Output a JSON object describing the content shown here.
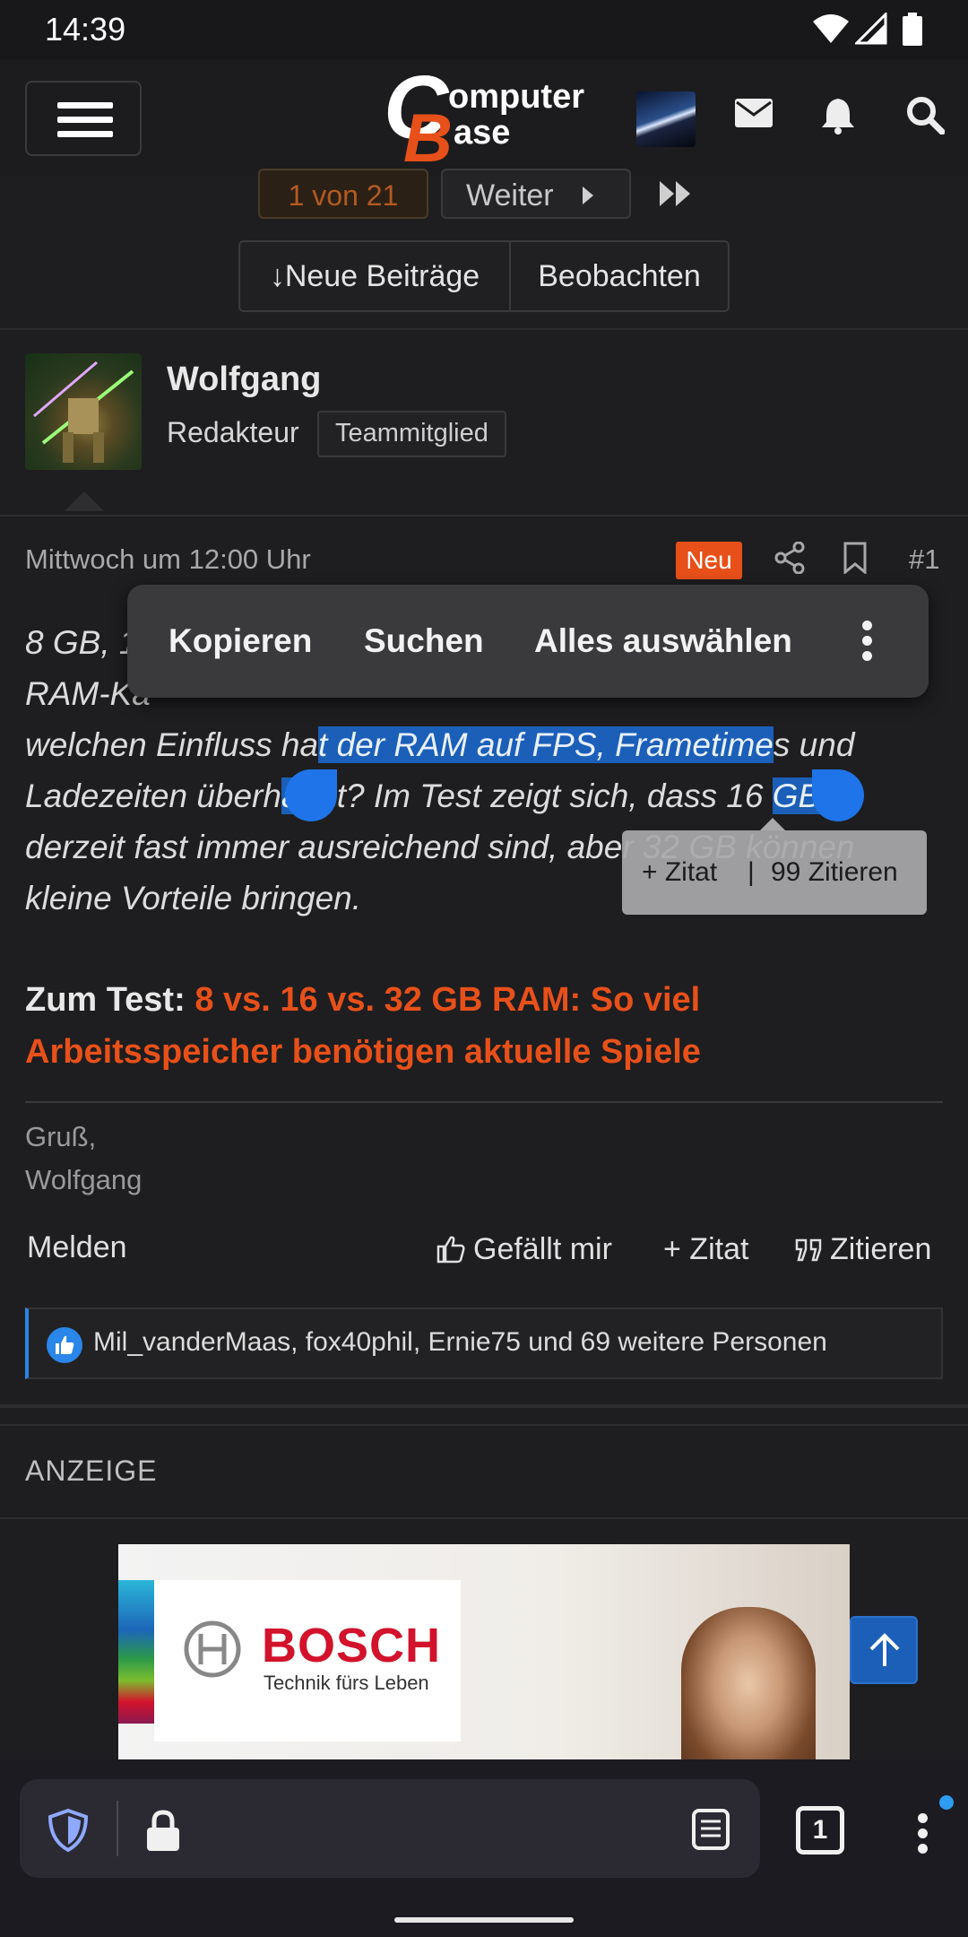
{
  "status_bar": {
    "time": "14:39"
  },
  "pagination": {
    "current": "1 von 21",
    "next": "Weiter"
  },
  "thread_buttons": {
    "new_posts": "Neue Beiträge",
    "watch": "Beobachten"
  },
  "user": {
    "name": "Wolfgang",
    "role": "Redakteur",
    "badge": "Teammitglied"
  },
  "post": {
    "date": "Mittwoch um 12:00 Uhr",
    "badge_new": "Neu",
    "number": "#1",
    "body_line1": "8 GB, 1",
    "body_line2": "RAM-Ka",
    "body_line3_pre": "welchen Einfluss ha",
    "body_line3_sel": "t der RAM auf FPS, Frametime",
    "body_line3_post": "s und",
    "body_line4_pre": "Ladezeiten überh",
    "body_line4_sel": "au",
    "body_line4_mid": "pt? Im Test zeigt sich, dass 16 ",
    "body_line4_sel2": "GB",
    "body_line5": "derzeit fast immer ausreichend sind, aber 32 GB können",
    "body_line6": "kleine Vorteile bringen.",
    "test_label": "Zum Test:",
    "test_link": "8 vs. 16 vs. 32 GB RAM: So viel Arbeitsspeicher benötigen aktuelle Spiele",
    "greeting_1": "Gruß,",
    "greeting_2": "Wolfgang"
  },
  "context_menu": {
    "copy": "Kopieren",
    "search": "Suchen",
    "select_all": "Alles auswählen"
  },
  "quote_popup": {
    "zitat": "+ Zitat",
    "separator": "|",
    "zitieren": "99 Zitieren"
  },
  "actions": {
    "report": "Melden",
    "like": "Gefällt mir",
    "quote": "+ Zitat",
    "cite": "Zitieren"
  },
  "likes": {
    "text": "Mil_vanderMaas, fox40phil, Ernie75 und 69 weitere Personen"
  },
  "ad": {
    "label": "ANZEIGE",
    "brand": "BOSCH",
    "slogan": "Technik fürs Leben"
  },
  "browser": {
    "tab_count": "1"
  },
  "colors": {
    "accent": "#e8501a",
    "selection": "#1b5fb8",
    "link_blue": "#2a86e8"
  }
}
